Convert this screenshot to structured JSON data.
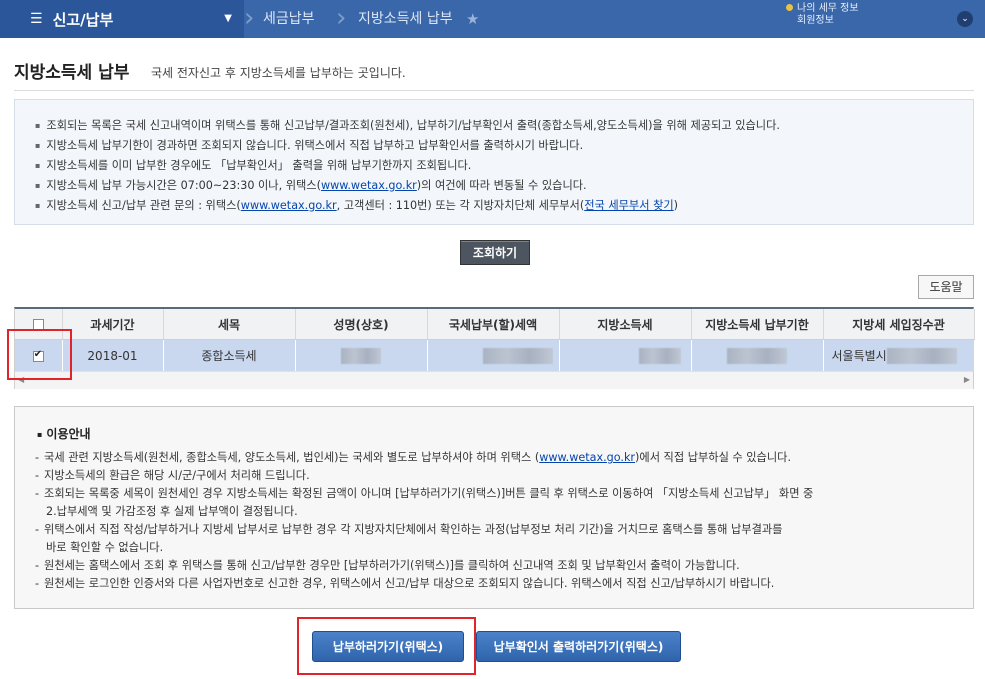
{
  "topbar": {
    "menu_icon": "hamburger-icon",
    "menu_title": "신고/납부",
    "breadcrumb": [
      "세금납부",
      "지방소득세 납부"
    ],
    "user_line1": "나의 세무 정보",
    "user_line2": "회원정보"
  },
  "page": {
    "title": "지방소득세 납부",
    "subtitle": "국세 전자신고 후 지방소득세를 납부하는 곳입니다."
  },
  "info": {
    "items": [
      "조회되는 목록은 국세 신고내역이며 위택스를 통해 신고납부/결과조회(원천세), 납부하기/납부확인서 출력(종합소득세,양도소득세)을 위해 제공되고 있습니다.",
      "지방소득세 납부기한이 경과하면 조회되지 않습니다. 위택스에서 직접 납부하고 납부확인서를 출력하시기 바랍니다.",
      "지방소득세를 이미 납부한 경우에도 「납부확인서」 출력을 위해 납부기한까지 조회됩니다."
    ],
    "time_prefix": "지방소득세 납부 가능시간은 07:00~23:30 이나, 위택스(",
    "time_link": "www.wetax.go.kr",
    "time_suffix": ")의 여건에 따라 변동될 수 있습니다.",
    "contact_prefix": "지방소득세 신고/납부 관련 문의 : 위택스(",
    "contact_link": "www.wetax.go.kr",
    "contact_middle": ", 고객센터 : 110번) 또는 각 지방자치단체 세무부서(",
    "contact_link2": "전국 세무부서 찾기",
    "contact_suffix": ")"
  },
  "search_button": "조회하기",
  "help_button": "도움말",
  "table": {
    "headers": [
      "과세기간",
      "세목",
      "성명(상호)",
      "국세납부(할)세액",
      "지방소득세",
      "지방소득세 납부기한",
      "지방세 세입징수관"
    ],
    "row": {
      "period": "2018-01",
      "tax_type": "종합소득세",
      "collector": "서울특별시"
    }
  },
  "guide": {
    "title": "이용안내",
    "line1_prefix": "국세 관련 지방소득세(원천세, 종합소득세, 양도소득세, 법인세)는 국세와 별도로 납부하셔야 하며 위택스 (",
    "line1_link": "www.wetax.go.kr",
    "line1_suffix": ")에서 직접 납부하실 수 있습니다.",
    "line2": "지방소득세의 환급은 해당 시/군/구에서 처리해 드립니다.",
    "line3a": "조회되는 목록중 세목이 원천세인 경우 지방소득세는 확정된 금액이 아니며 [납부하러가기(위택스)]버튼 클릭 후 위택스로 이동하여 「지방소득세 신고납부」 화면 중",
    "line3b": "2.납부세액 및 가감조정 후 실제 납부액이 결정됩니다.",
    "line4a": "위택스에서 직접 작성/납부하거나 지방세 납부서로 납부한 경우 각 지방자치단체에서 확인하는 과정(납부정보 처리 기간)을 거치므로 홈택스를 통해 납부결과를",
    "line4b": "바로 확인할 수 없습니다.",
    "line5": "원천세는 홈택스에서 조회 후 위택스를 통해 신고/납부한 경우만 [납부하러가기(위택스)]를 클릭하여 신고내역 조회 및 납부확인서 출력이 가능합니다.",
    "line6": "원천세는 로그인한 인증서와 다른 사업자번호로 신고한 경우, 위택스에서 신고/납부 대상으로 조회되지 않습니다. 위택스에서 직접 신고/납부하시기 바랍니다."
  },
  "buttons": {
    "pay": "납부하러가기(위택스)",
    "receipt": "납부확인서 출력하러가기(위택스)"
  },
  "colors": {
    "nav": "#3a67a9",
    "selected_row": "#c9d8ef",
    "highlight": "#e0242a",
    "primary_button": "#2f64ad"
  }
}
